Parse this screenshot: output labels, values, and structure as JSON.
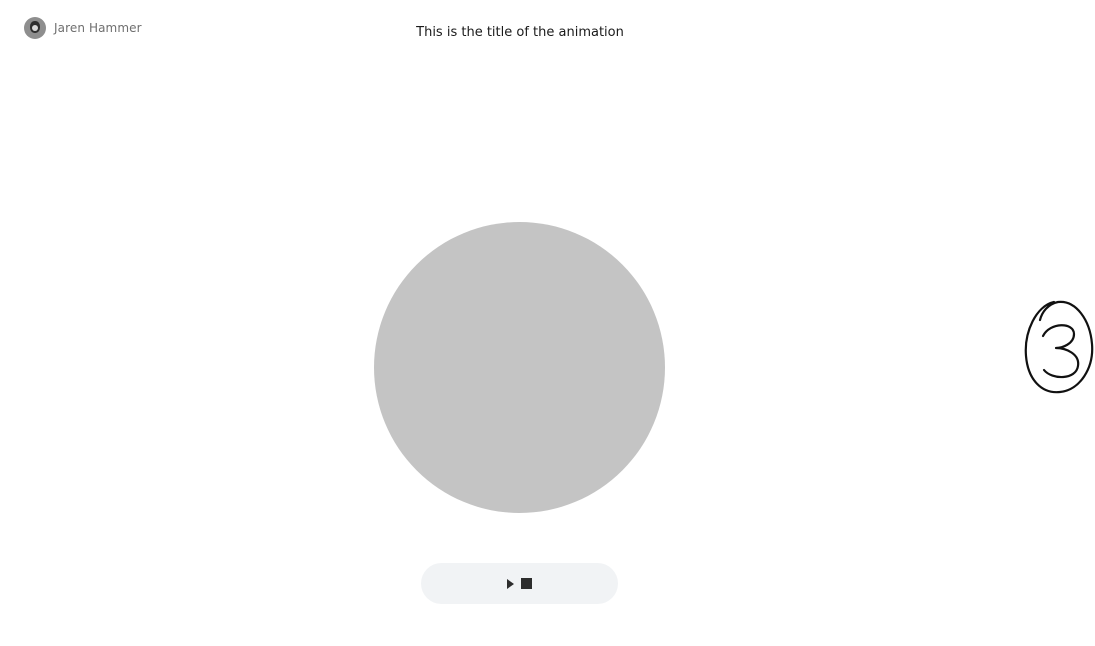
{
  "author": {
    "name": "Jaren Hammer",
    "avatar_icon": "user-avatar"
  },
  "animation": {
    "title": "This is the title of the animation",
    "shape": "circle",
    "shape_color": "#c4c4c4"
  },
  "controls": {
    "play_icon": "play-icon",
    "stop_icon": "stop-icon",
    "background": "#f1f3f5"
  },
  "annotation": {
    "number": "3"
  }
}
